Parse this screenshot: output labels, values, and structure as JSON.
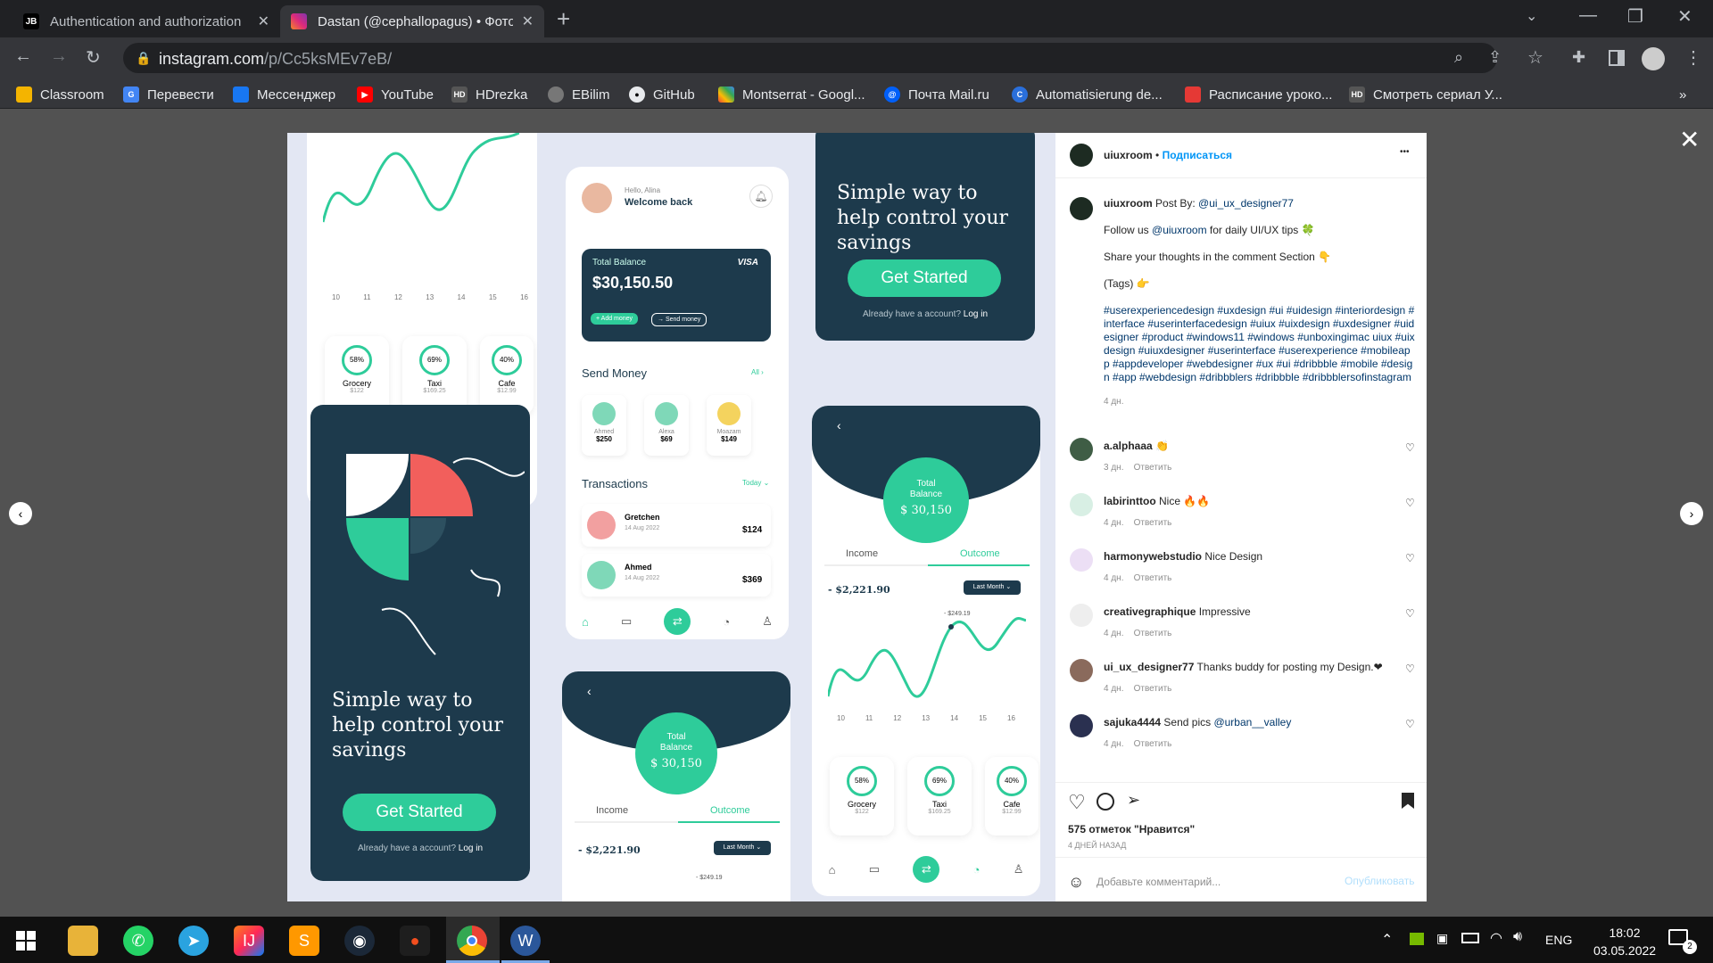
{
  "browser": {
    "tabs": [
      {
        "icon": "JB",
        "title": "Authentication and authorization"
      },
      {
        "icon": "instagram-icon",
        "title": "Dastan (@cephallopagus) • Фото"
      }
    ],
    "url_host": "instagram.com",
    "url_path": "/p/Cc5ksMEv7eB/",
    "bookmarks": [
      "Classroom",
      "Перевести",
      "Мессенджер",
      "YouTube",
      "HDrezka",
      "EBilim",
      "GitHub",
      "Montserrat - Googl...",
      "Почта Mail.ru",
      "Automatisierung de...",
      "Расписание уроко...",
      "Смотреть сериал У..."
    ],
    "bookmark_more": "»"
  },
  "post_image": {
    "chart_ticks": [
      "10",
      "11",
      "12",
      "13",
      "14",
      "15",
      "16"
    ],
    "categories": [
      {
        "pct": "58%",
        "name": "Grocery",
        "amt": "$122"
      },
      {
        "pct": "69%",
        "name": "Taxi",
        "amt": "$169.25"
      },
      {
        "pct": "40%",
        "name": "Cafe",
        "amt": "$12.99"
      }
    ],
    "headline": "Simple way to help control your savings",
    "get_started": "Get Started",
    "already": "Already have a account?",
    "login": "Log in",
    "greeting": "Hello, Alina",
    "welcome": "Welcome back",
    "total_balance_label": "Total Balance",
    "balance": "$30,150.50",
    "card_brand": "VISA",
    "add_money": "+ Add money",
    "send_money_btn": "→ Send money",
    "send_money": "Send Money",
    "all": "All ›",
    "contacts": [
      {
        "name": "Ahmed",
        "amt": "$250"
      },
      {
        "name": "Alexa",
        "amt": "$69"
      },
      {
        "name": "Moazam",
        "amt": "$149"
      }
    ],
    "transactions": "Transactions",
    "today": "Today ⌄",
    "tx": [
      {
        "name": "Gretchen",
        "date": "14 Aug 2022",
        "amt": "$124"
      },
      {
        "name": "Ahmed",
        "date": "14 Aug 2022",
        "amt": "$369"
      }
    ],
    "total_balance_circle": "Total Balance",
    "balance_short": "$ 30,150",
    "income": "Income",
    "outcome": "Outcome",
    "minus_amount": "- $2,221.90",
    "last_month": "Last Month ⌄",
    "point_label": "- $249.19"
  },
  "sidebar": {
    "author": "uiuxroom",
    "dot": "•",
    "follow": "Подписаться",
    "more": "•••",
    "caption_user": "uiuxroom",
    "caption_text": "Post By: ",
    "caption_mention": "@ui_ux_designer77",
    "line1_a": "Follow us ",
    "line1_mention": "@uiuxroom",
    "line1_b": " for daily UI/UX tips 🍀",
    "line2": "Share your thoughts in the comment Section 👇",
    "line3": "(Tags) 👉",
    "hashtags": "#userexperiencedesign #uxdesign #ui #uidesign #interiordesign #interface #userinterfacedesign #uiux #uixdesign #uxdesigner #uidesigner #product #windows11 #windows #unboxingimac uiux #uixdesign #uiuxdesigner #userinterface #userexperience #mobileapp #appdeveloper #webdesigner #ux #ui #dribbble #mobile #design #app #webdesign #dribbblers #dribbble #dribbblersofinstagram",
    "caption_time": "4 дн.",
    "reply": "Ответить",
    "comments": [
      {
        "user": "a.alphaaa",
        "text": "👏",
        "time": "3 дн."
      },
      {
        "user": "labirinttoo",
        "text": "Nice 🔥🔥",
        "time": "4 дн."
      },
      {
        "user": "harmonywebstudio",
        "text": "Nice Design",
        "time": "4 дн."
      },
      {
        "user": "creativegraphique",
        "text": "Impressive",
        "time": "4 дн."
      },
      {
        "user": "ui_ux_designer77",
        "text": "Thanks buddy for posting my Design.❤",
        "time": "4 дн."
      },
      {
        "user": "sajuka4444",
        "text": "Send pics ",
        "mention": "@urban__valley",
        "time": "4 дн."
      }
    ],
    "likes": "575 отметок \"Нравится\"",
    "posted": "4 ДНЕЙ НАЗАД",
    "comment_placeholder": "Добавьте комментарий...",
    "publish": "Опубликовать"
  },
  "taskbar": {
    "lang": "ENG",
    "time": "18:02",
    "date": "03.05.2022",
    "notif": "2"
  }
}
